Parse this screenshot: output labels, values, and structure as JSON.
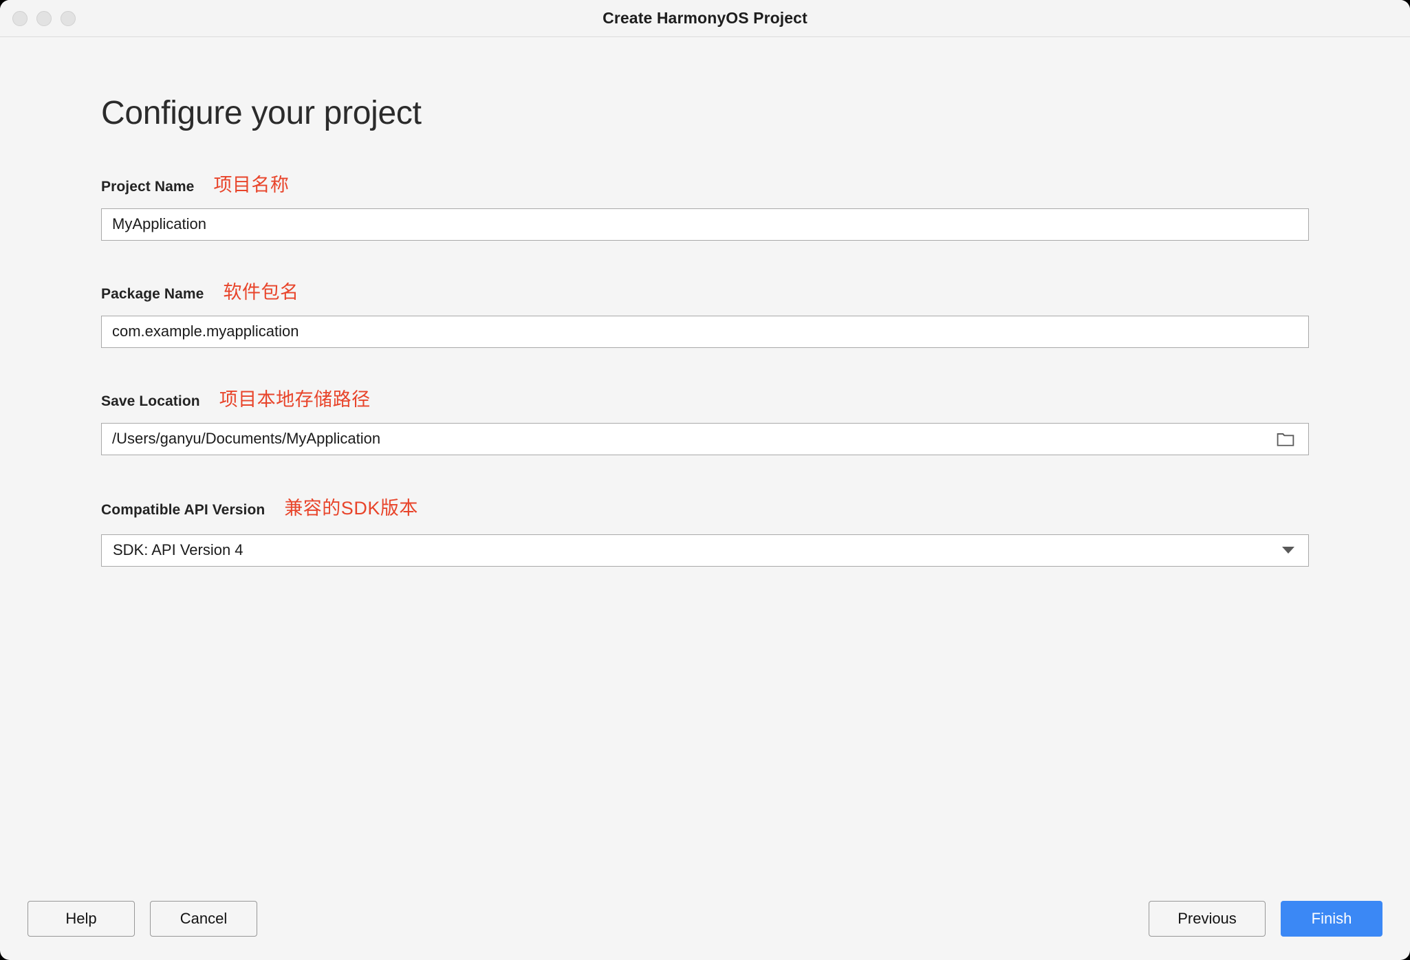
{
  "window": {
    "title": "Create HarmonyOS Project",
    "traffic_lights": [
      "close",
      "minimize",
      "zoom"
    ]
  },
  "main": {
    "heading": "Configure your project",
    "fields": [
      {
        "label": "Project Name",
        "annotation": "项目名称",
        "value": "MyApplication",
        "type": "text"
      },
      {
        "label": "Package Name",
        "annotation": "软件包名",
        "value": "com.example.myapplication",
        "type": "text"
      },
      {
        "label": "Save Location",
        "annotation": "项目本地存储路径",
        "value": "/Users/ganyu/Documents/MyApplication",
        "type": "text-with-browse",
        "browse_icon": "folder-icon"
      },
      {
        "label": "Compatible API Version",
        "annotation": "兼容的SDK版本",
        "value": "SDK: API Version 4",
        "type": "select",
        "caret_icon": "chevron-down-icon"
      }
    ]
  },
  "footer": {
    "help_label": "Help",
    "cancel_label": "Cancel",
    "previous_label": "Previous",
    "finish_label": "Finish"
  },
  "colors": {
    "annotation_red": "#e8442a",
    "primary_blue": "#3b88f5",
    "window_bg": "#f5f5f5",
    "field_border": "#a9a9a9"
  }
}
